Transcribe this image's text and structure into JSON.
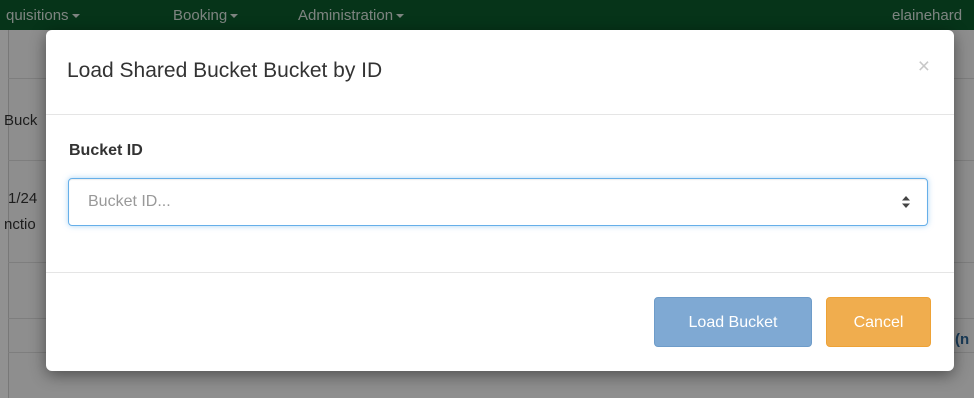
{
  "navbar": {
    "items": [
      {
        "label": "quisitions"
      },
      {
        "label": "Booking"
      },
      {
        "label": "Administration"
      }
    ],
    "user": "elainehard"
  },
  "background": {
    "fragment_1": "Buck",
    "fragment_2": "1/24",
    "fragment_3": "nctio",
    "fragment_4": "(n"
  },
  "modal": {
    "title": "Load Shared Bucket Bucket by ID",
    "close_glyph": "×",
    "field": {
      "label": "Bucket ID",
      "value": "",
      "placeholder": "Bucket ID..."
    },
    "footer": {
      "load_label": "Load Bucket",
      "cancel_label": "Cancel"
    }
  },
  "colors": {
    "navbar": "#0b5a2c",
    "primary_button": "#7fa9d3",
    "warning_button": "#f0ad4e",
    "focus_border": "#66afe9"
  }
}
